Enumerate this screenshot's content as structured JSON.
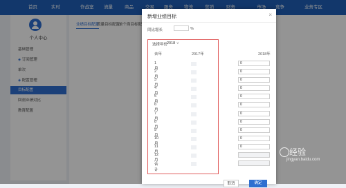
{
  "topnav": {
    "items": [
      "首页",
      "实时",
      "作战室",
      "流量",
      "商品",
      "交易",
      "服务",
      "物流",
      "营销",
      "财务",
      "市场",
      "竞争",
      "业务专区"
    ]
  },
  "sidebar": {
    "title": "个人中心",
    "items": [
      {
        "label": "基础管理"
      },
      {
        "label": "订阅管理"
      },
      {
        "label": "单次"
      },
      {
        "label": "配置管理"
      },
      {
        "label": "目标配置"
      },
      {
        "label": "回测业绩对比"
      },
      {
        "label": "教育配置"
      }
    ]
  },
  "content": {
    "tabs": [
      "业绩目标配置",
      "流量目标配置",
      "单个商目标配置"
    ]
  },
  "modal": {
    "title": "新增业绩目标",
    "close": "×",
    "growth_label": "同比增长",
    "growth_unit": "%",
    "year_label": "选择年份",
    "year_value": "2018",
    "year_arrow": "∨",
    "col_month": "去年",
    "col_2017": "2017年",
    "col_2018": "2018年",
    "months": [
      "1月",
      "2月",
      "3月",
      "4月",
      "5月",
      "6月",
      "7月",
      "8月",
      "9月",
      "10月",
      "11月",
      "12月",
      "合计"
    ],
    "input_values": [
      "0",
      "0",
      "0",
      "0",
      "0",
      "0",
      "0",
      "0",
      "0",
      "0",
      "0",
      "",
      ""
    ],
    "cancel": "取消",
    "confirm": "确定"
  },
  "watermark": {
    "text": "经验",
    "url": "jingyan.baidu.com"
  },
  "colors": {
    "brand": "#1f5fb8",
    "accent": "#2f6fd0",
    "highlight": "#e05a5a"
  }
}
